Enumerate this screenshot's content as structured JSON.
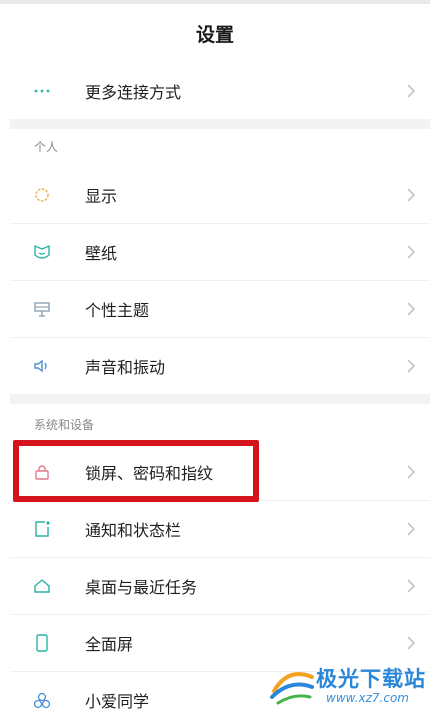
{
  "header": {
    "title": "设置"
  },
  "sections": {
    "personal": "个人",
    "system": "系统和设备"
  },
  "rows": {
    "more_connect": {
      "label": "更多连接方式",
      "icon": "more-dots-icon"
    },
    "display": {
      "label": "显示",
      "icon": "brightness-icon"
    },
    "wallpaper": {
      "label": "壁纸",
      "icon": "wallpaper-icon"
    },
    "theme": {
      "label": "个性主题",
      "icon": "theme-icon"
    },
    "sound": {
      "label": "声音和振动",
      "icon": "speaker-icon"
    },
    "lock": {
      "label": "锁屏、密码和指纹",
      "icon": "lock-icon"
    },
    "notify": {
      "label": "通知和状态栏",
      "icon": "notification-icon"
    },
    "home": {
      "label": "桌面与最近任务",
      "icon": "home-icon"
    },
    "fullscreen": {
      "label": "全面屏",
      "icon": "phone-icon"
    },
    "xiaoai": {
      "label": "小爱同学",
      "icon": "xiaoai-icon"
    }
  },
  "watermark": {
    "title": "极光下载站",
    "url": "www.xz7.com"
  },
  "colors": {
    "accent_teal": "#2bb3a3",
    "highlight_red": "#d3141c",
    "lock_pink": "#e07a8a",
    "watermark_blue": "#2a86d9"
  }
}
